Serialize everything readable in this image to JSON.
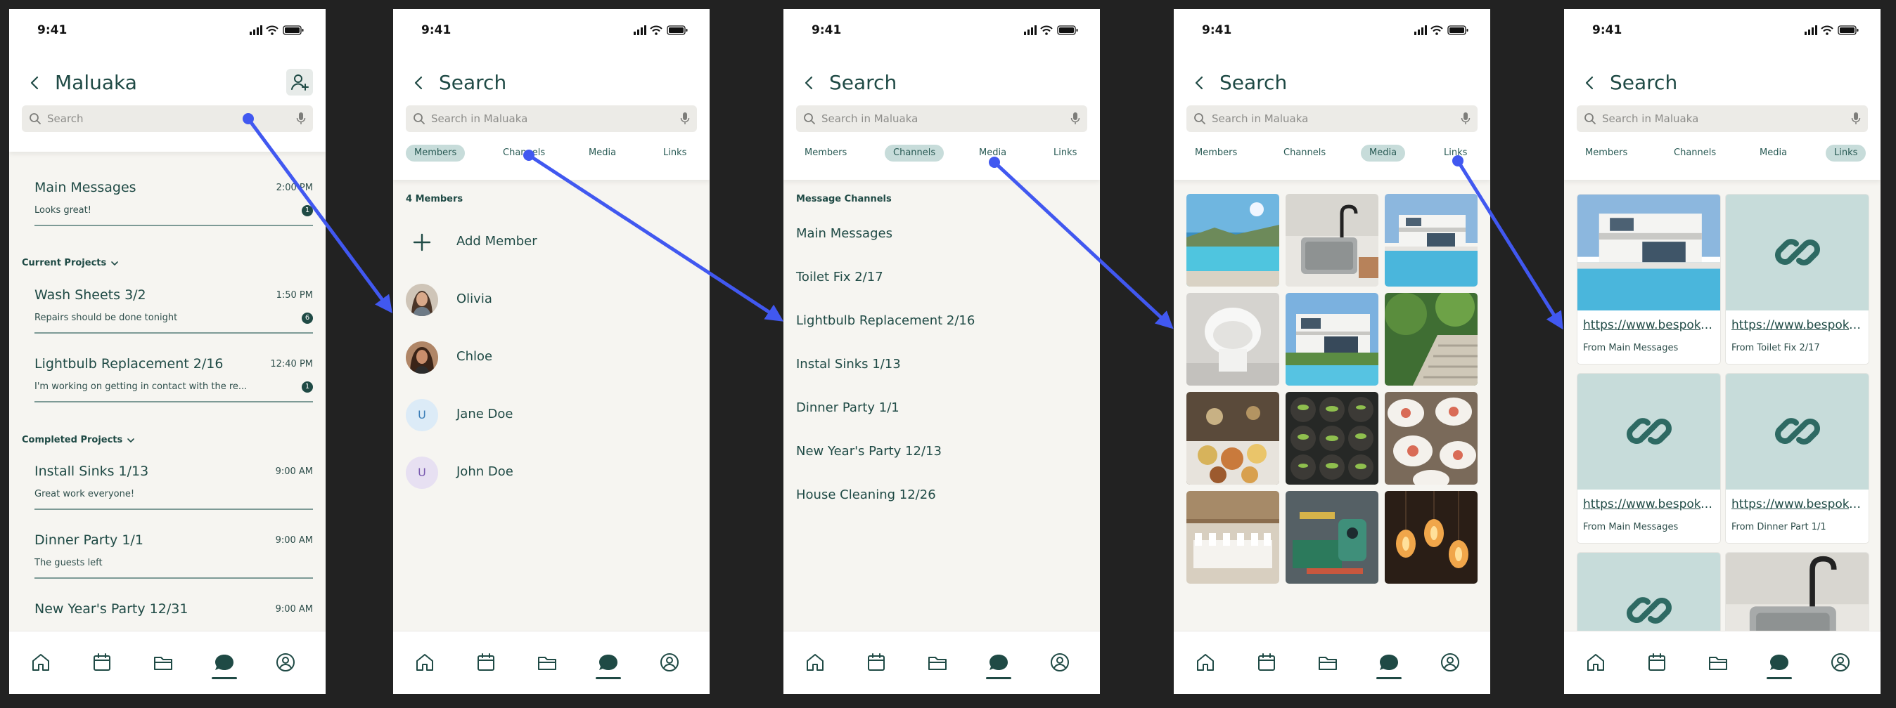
{
  "status_time": "9:41",
  "screens": {
    "chat": {
      "title": "Maluaka",
      "search_placeholder": "Search",
      "main": {
        "title": "Main Messages",
        "time": "2:00 PM",
        "preview": "Looks great!",
        "badge": "1"
      },
      "current_label": "Current Projects",
      "current": [
        {
          "title": "Wash Sheets 3/2",
          "time": "1:50 PM",
          "preview": "Repairs should be done tonight",
          "badge": "6"
        },
        {
          "title": "Lightbulb Replacement 2/16",
          "time": "12:40 PM",
          "preview": "I'm working on getting in contact with the re...",
          "badge": "1"
        }
      ],
      "completed_label": "Completed Projects",
      "completed": [
        {
          "title": "Install Sinks 1/13",
          "time": "9:00 AM",
          "preview": "Great work everyone!"
        },
        {
          "title": "Dinner Party 1/1",
          "time": "9:00 AM",
          "preview": "The guests left"
        },
        {
          "title": "New Year's Party 12/31",
          "time": "9:00 AM",
          "preview": ""
        }
      ]
    },
    "search": {
      "title": "Search",
      "placeholder": "Search in Maluaka",
      "tabs": [
        "Members",
        "Channels",
        "Media",
        "Links"
      ]
    },
    "members": {
      "count_label": "4 Members",
      "add_label": "Add Member",
      "list": [
        {
          "name": "Olivia",
          "avatar": "photo"
        },
        {
          "name": "Chloe",
          "avatar": "photo"
        },
        {
          "name": "Jane Doe",
          "avatar": "U",
          "avatar_bg": "#dcebf7",
          "avatar_color": "#3d7fb8"
        },
        {
          "name": "John Doe",
          "avatar": "U",
          "avatar_bg": "#e7e0f2",
          "avatar_color": "#7a5bb0"
        }
      ]
    },
    "channels": {
      "heading": "Message Channels",
      "list": [
        "Main Messages",
        "Toilet Fix 2/17",
        "Lightbulb Replacement 2/16",
        "Instal Sinks 1/13",
        "Dinner Party 1/1",
        "New Year's Party 12/13",
        "House Cleaning 12/26"
      ]
    },
    "media": {
      "images": [
        "pool-sea-photo",
        "steel-sink-photo",
        "villa-pool-photo",
        "toilet-photo",
        "modern-house-photo",
        "garden-steps-photo",
        "party-food-photo",
        "seedlings-photo",
        "plated-dishes-photo",
        "banquet-hall-photo",
        "tools-photo",
        "lightbulbs-photo"
      ]
    },
    "links": {
      "cards": [
        {
          "url": "https://www.bespoke.com",
          "from": "From Main Messages",
          "thumb": "villa-pool-photo"
        },
        {
          "url": "https://www.bespoke.com",
          "from": "From Toilet Fix 2/17",
          "thumb": "link-icon"
        },
        {
          "url": "https://www.bespoke.com",
          "from": "From Main Messages",
          "thumb": "link-icon"
        },
        {
          "url": "https://www.bespoke.com",
          "from": "From Dinner Part 1/1",
          "thumb": "link-icon"
        },
        {
          "url": "",
          "from": "",
          "thumb": "link-icon"
        },
        {
          "url": "",
          "from": "",
          "thumb": "steel-sink-photo"
        }
      ]
    }
  },
  "tabbar": [
    "home-icon",
    "calendar-icon",
    "folder-icon",
    "chat-icon",
    "profile-icon"
  ],
  "colors": {
    "accent": "#1f4a45",
    "tab_active_bg": "#c7dcda",
    "arrow": "#4158f0",
    "canvas": "#222222"
  }
}
